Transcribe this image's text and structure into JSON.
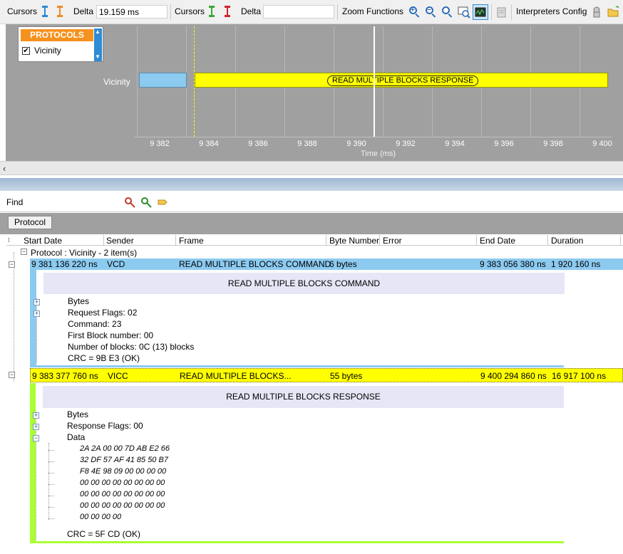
{
  "toolbar": {
    "cursors_label_1": "Cursors",
    "delta_label_1": "Delta",
    "delta_value_1": "19.159 ms",
    "cursors_label_2": "Cursors",
    "delta_label_2": "Delta",
    "zoom_label": "Zoom Functions",
    "interpreters_label": "Interpreters Config"
  },
  "chart": {
    "protocols_title": "PROTOCOLS",
    "protocol_item": "Vicinity",
    "protocol_checked": true,
    "track_label": "Vicinity",
    "response_bar_label": "READ MULTIPLE BLOCKS RESPONSE",
    "x_axis_title": "Time (ms)",
    "x_ticks": [
      "9 382",
      "9 384",
      "9 386",
      "9 388",
      "9 390",
      "9 392",
      "9 394",
      "9 396",
      "9 398",
      "9 400"
    ]
  },
  "find": {
    "label": "Find",
    "value": ""
  },
  "tabs": {
    "protocol": "Protocol"
  },
  "columns": [
    "Start Date",
    "Sender",
    "Frame",
    "Byte Number",
    "Error",
    "End Date",
    "Duration"
  ],
  "tree": {
    "group_label": "Protocol : Vicinity - 2 item(s)",
    "rows": [
      {
        "start": "9 381 136 220 ns",
        "sender": "VCD",
        "frame": "READ MULTIPLE BLOCKS COMMAND",
        "bytes": "6 bytes",
        "end": "9 383 056 380 ns",
        "duration": "1 920 160 ns",
        "detail_title": "READ MULTIPLE BLOCKS COMMAND",
        "detail_lines": [
          "Bytes",
          "Request Flags: 02",
          "Command: 23",
          "First Block number: 00",
          "Number of blocks: 0C (13) blocks",
          "CRC = 9B E3 (OK)"
        ]
      },
      {
        "start": "9 383 377 760 ns",
        "sender": "VICC",
        "frame": "READ  MULTIPLE  BLOCKS...",
        "bytes": "55 bytes",
        "end": "9 400 294 860 ns",
        "duration": "16 917 100 ns",
        "detail_title": "READ MULTIPLE BLOCKS RESPONSE",
        "detail_lines": [
          "Bytes",
          "Response Flags: 00",
          "Data"
        ],
        "data_hex": [
          "2A 2A 00 00 7D AB E2 66",
          "32 DF 57 AF 41 85 50 B7",
          "F8 4E 98 09 00 00 00 00",
          "00 00 00 00 00 00 00 00",
          "00 00 00 00 00 00 00 00",
          "00 00 00 00 00 00 00 00",
          "00 00 00 00"
        ],
        "crc": "CRC = 5F CD (OK)"
      }
    ]
  },
  "colors": {
    "command_row": "#8ccaf0",
    "response_row": "#ffff00",
    "detail_header": "#e6e6f7",
    "response_accent": "#aaff33",
    "protocols_head": "#f5921e"
  }
}
